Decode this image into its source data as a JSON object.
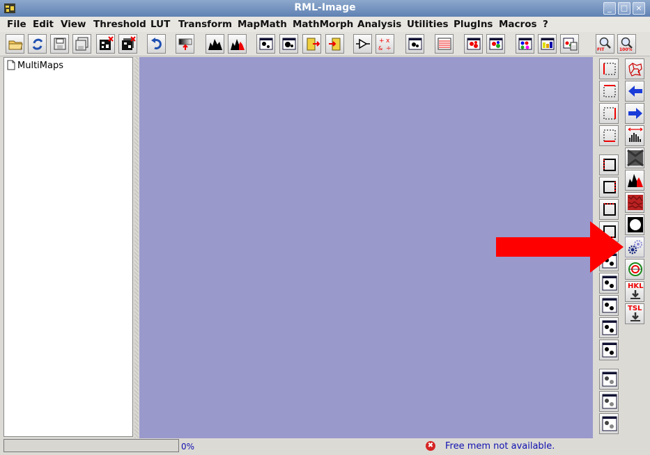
{
  "window": {
    "title": "RML-Image"
  },
  "menubar": [
    "File",
    "Edit",
    "View",
    "Threshold",
    "LUT",
    "Transform",
    "MapMath",
    "MathMorph",
    "Analysis",
    "Utilities",
    "PlugIns",
    "Macros",
    "?"
  ],
  "toolbar": {
    "zoom_fit_label": "FIT",
    "zoom_100_label": "100%"
  },
  "tree": {
    "root_label": "MultiMaps"
  },
  "right_tools": {
    "hkl_label": "HKL",
    "tsl_label": "TSL"
  },
  "status": {
    "progress_text": "0%",
    "progress": 0,
    "memory_text": "Free mem not available."
  },
  "colors": {
    "canvas": "#9999cc",
    "accent_red": "#ff0000",
    "status_text": "#1010b0"
  }
}
